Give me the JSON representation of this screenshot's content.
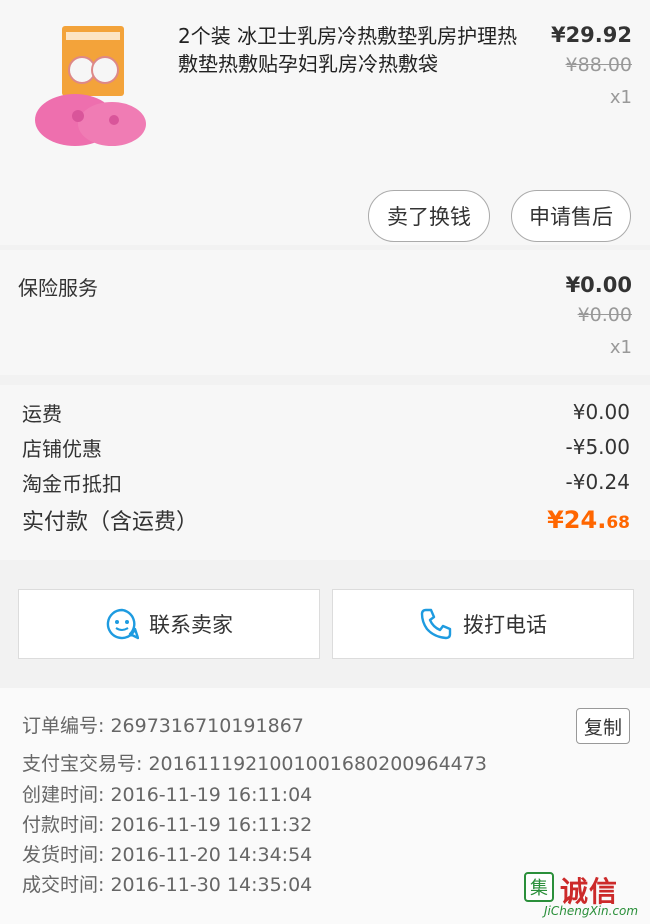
{
  "product": {
    "title": "2个装 冰卫士乳房冷热敷垫乳房护理热敷垫热敷贴孕妇乳房冷热敷袋",
    "price_now": "¥29.92",
    "price_old": "¥88.00",
    "qty": "x1"
  },
  "actions": {
    "sell_label": "卖了换钱",
    "after_sale_label": "申请售后"
  },
  "insurance": {
    "label": "保险服务",
    "price_now": "¥0.00",
    "price_old": "¥0.00",
    "qty": "x1"
  },
  "fees": {
    "shipping_label": "运费",
    "shipping_value": "¥0.00",
    "shop_discount_label": "店铺优惠",
    "shop_discount_value": "-¥5.00",
    "coin_label": "淘金币抵扣",
    "coin_value": "-¥0.24",
    "total_label": "实付款（含运费）",
    "total_main": "¥24.",
    "total_cents": "68",
    "total_color": "#ff6600"
  },
  "contact": {
    "seller_label": "联系卖家",
    "phone_label": "拨打电话",
    "icon_color": "#1e9be0"
  },
  "order": {
    "order_no_label": "订单编号:",
    "order_no": "2697316710191867",
    "copy_label": "复制",
    "alipay_label": "支付宝交易号:",
    "alipay_no": "2016111921001001680200964473",
    "created_label": "创建时间:",
    "created": "2016-11-19 16:11:04",
    "paid_label": "付款时间:",
    "paid": "2016-11-19 16:11:32",
    "shipped_label": "发货时间:",
    "shipped": "2016-11-20 14:34:54",
    "closed_label": "成交时间:",
    "closed": "2016-11-30 14:35:04"
  },
  "watermark": {
    "logo_char": "集",
    "text": "诚信",
    "url": "JiChengXin.com"
  }
}
